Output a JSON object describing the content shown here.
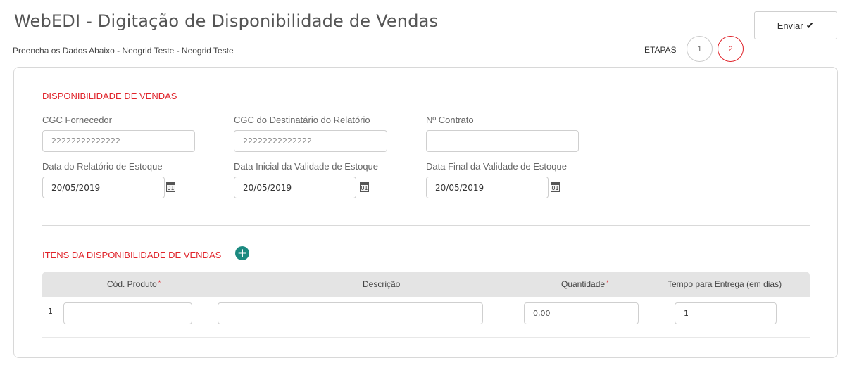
{
  "header": {
    "title": "WebEDI - Digitação de Disponibilidade de Vendas",
    "subtitle": "Preencha os Dados Abaixo - Neogrid Teste - Neogrid Teste",
    "send_label": "Enviar",
    "steps_label": "ETAPAS",
    "steps": [
      "1",
      "2"
    ],
    "active_step": "2"
  },
  "form": {
    "section_title": "DISPONIBILIDADE DE VENDAS",
    "cgc_fornecedor": {
      "label": "CGC Fornecedor",
      "value": "22222222222222"
    },
    "cgc_destinatario": {
      "label": "CGC do Destinatário do Relatório",
      "value": "22222222222222"
    },
    "contrato": {
      "label": "Nº Contrato",
      "value": ""
    },
    "data_relatorio": {
      "label": "Data do Relatório de Estoque",
      "value": "20/05/2019"
    },
    "data_inicial": {
      "label": "Data Inicial da Validade de Estoque",
      "value": "20/05/2019"
    },
    "data_final": {
      "label": "Data Final da Validade de Estoque",
      "value": "20/05/2019"
    },
    "calendar_icon_text": "01"
  },
  "items": {
    "section_title": "ITENS DA DISPONIBILIDADE DE VENDAS",
    "columns": {
      "cod_produto": "Cód. Produto",
      "descricao": "Descrição",
      "quantidade": "Quantidade",
      "tempo_entrega": "Tempo para Entrega (em dias)"
    },
    "required_mark": "*",
    "rows": [
      {
        "num": "1",
        "cod_produto": "",
        "descricao": "",
        "quantidade": "0,00",
        "tempo_entrega": "1"
      }
    ]
  },
  "colors": {
    "accent_red": "#e0242b",
    "add_green": "#1b8a80"
  }
}
